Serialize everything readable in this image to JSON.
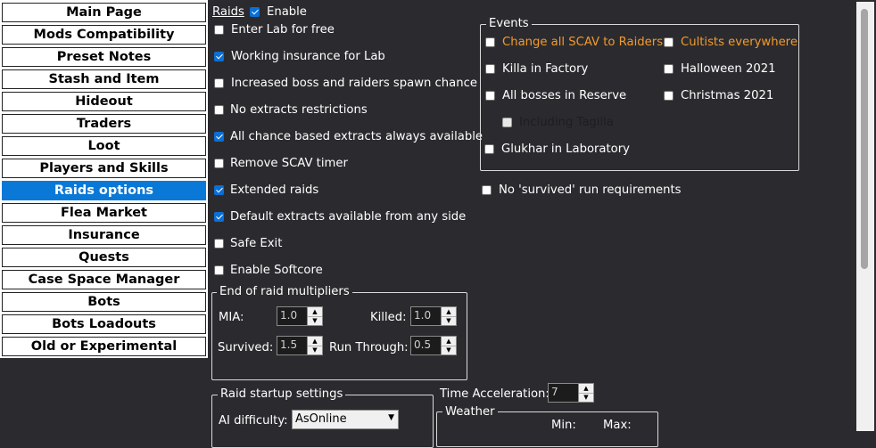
{
  "sidebar": {
    "items": [
      {
        "label": "Main Page"
      },
      {
        "label": "Mods Compatibility"
      },
      {
        "label": "Preset Notes"
      },
      {
        "label": "Stash and Item"
      },
      {
        "label": "Hideout"
      },
      {
        "label": "Traders"
      },
      {
        "label": "Loot"
      },
      {
        "label": "Players and Skills"
      },
      {
        "label": "Raids options",
        "active": true
      },
      {
        "label": "Flea Market"
      },
      {
        "label": "Insurance"
      },
      {
        "label": "Quests"
      },
      {
        "label": "Case Space Manager"
      },
      {
        "label": "Bots"
      },
      {
        "label": "Bots Loadouts"
      },
      {
        "label": "Old or Experimental"
      }
    ]
  },
  "raids": {
    "title": "Raids",
    "enable_label": "Enable",
    "enabled": true,
    "options": [
      {
        "label": "Enter Lab for free",
        "checked": false
      },
      {
        "label": "Working insurance for Lab",
        "checked": true
      },
      {
        "label": "Increased boss and raiders spawn chance",
        "checked": false
      },
      {
        "label": "No extracts restrictions",
        "checked": false
      },
      {
        "label": "All chance based extracts always available",
        "checked": true
      },
      {
        "label": "Remove SCAV timer",
        "checked": false
      },
      {
        "label": "Extended raids",
        "checked": true
      },
      {
        "label": "Default extracts available from any side",
        "checked": true
      },
      {
        "label": "Safe Exit",
        "checked": false
      },
      {
        "label": "Enable Softcore",
        "checked": false
      }
    ],
    "no_survived_label": "No 'survived' run requirements",
    "no_survived_checked": false
  },
  "events": {
    "title": "Events",
    "items": [
      {
        "label": "Change all SCAV to Raiders",
        "checked": false,
        "highlight": true
      },
      {
        "label": "Cultists everywhere",
        "checked": false,
        "highlight": true
      },
      {
        "label": "Killa in Factory",
        "checked": false
      },
      {
        "label": "Halloween 2021",
        "checked": false
      },
      {
        "label": "All bosses in Reserve",
        "checked": false
      },
      {
        "label": "Christmas 2021",
        "checked": false
      },
      {
        "label": "Including Tagilla",
        "checked": false,
        "disabled": true
      },
      {
        "label": "Glukhar in Laboratory",
        "checked": false
      }
    ]
  },
  "multipliers": {
    "title": "End of raid multipliers",
    "mia_label": "MIA:",
    "mia_value": "1.0",
    "killed_label": "Killed:",
    "killed_value": "1.0",
    "survived_label": "Survived:",
    "survived_value": "1.5",
    "runthrough_label": "Run Through:",
    "runthrough_value": "0.5"
  },
  "startup": {
    "title": "Raid startup settings",
    "ai_label": "AI difficulty:",
    "ai_value": "AsOnline"
  },
  "time_acceleration": {
    "label": "Time Acceleration:",
    "value": "7"
  },
  "weather": {
    "title": "Weather",
    "min_label": "Min:",
    "max_label": "Max:"
  },
  "colors": {
    "accent": "#0a78d7",
    "highlight": "#f39a2b",
    "background": "#2b2b2f"
  }
}
